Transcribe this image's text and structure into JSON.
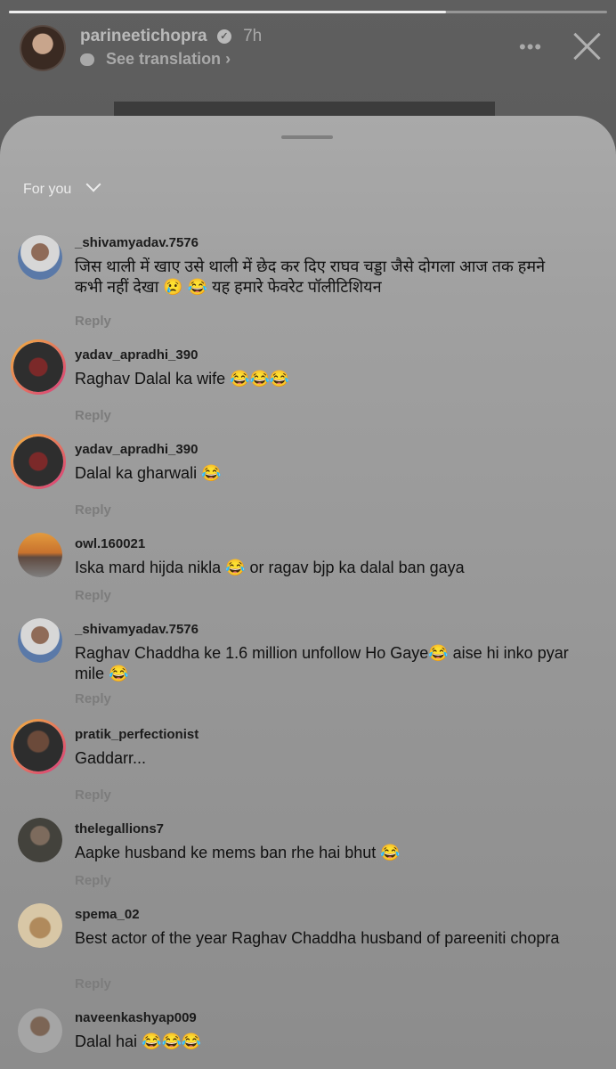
{
  "header": {
    "username": "parineetichopra",
    "time": "7h",
    "see_translation": "See translation"
  },
  "sheet": {
    "filter_label": "For you"
  },
  "comments": [
    {
      "username": "_shivamyadav.7576",
      "text": "जिस थाली में खाए उसे थाली में छेद कर दिए राघव चड्डा जैसे दोगला आज तक हमने कभी नहीं देखा 😢 😂 यह हमारे फेवरेट पॉलीटिशियन",
      "reply": "Reply"
    },
    {
      "username": "yadav_apradhi_390",
      "text": "Raghav Dalal ka wife 😂😂😂",
      "reply": "Reply"
    },
    {
      "username": "yadav_apradhi_390",
      "text": "Dalal ka gharwali 😂",
      "reply": "Reply"
    },
    {
      "username": "owl.160021",
      "text": "Iska mard hijda nikla 😂 or ragav bjp ka dalal ban gaya",
      "reply": "Reply"
    },
    {
      "username": "_shivamyadav.7576",
      "text": "Raghav Chaddha ke 1.6 million unfollow Ho Gaye😂 aise hi inko pyar mile 😂",
      "reply": "Reply"
    },
    {
      "username": "pratik_perfectionist",
      "text": "Gaddarr...",
      "reply": "Reply"
    },
    {
      "username": "thelegallions7",
      "text": "Aapke husband ke mems ban rhe hai bhut 😂",
      "reply": "Reply"
    },
    {
      "username": "spema_02",
      "text": "Best actor of the year Raghav Chaddha husband of pareeniti chopra",
      "reply": "Reply"
    },
    {
      "username": "naveenkashyap009",
      "text": "Dalal hai 😂😂😂",
      "reply": ""
    }
  ],
  "colors": {
    "sheet_bg": "#a3a3a3",
    "username": "#1b1b1b",
    "reply": "#7c7c7c"
  }
}
